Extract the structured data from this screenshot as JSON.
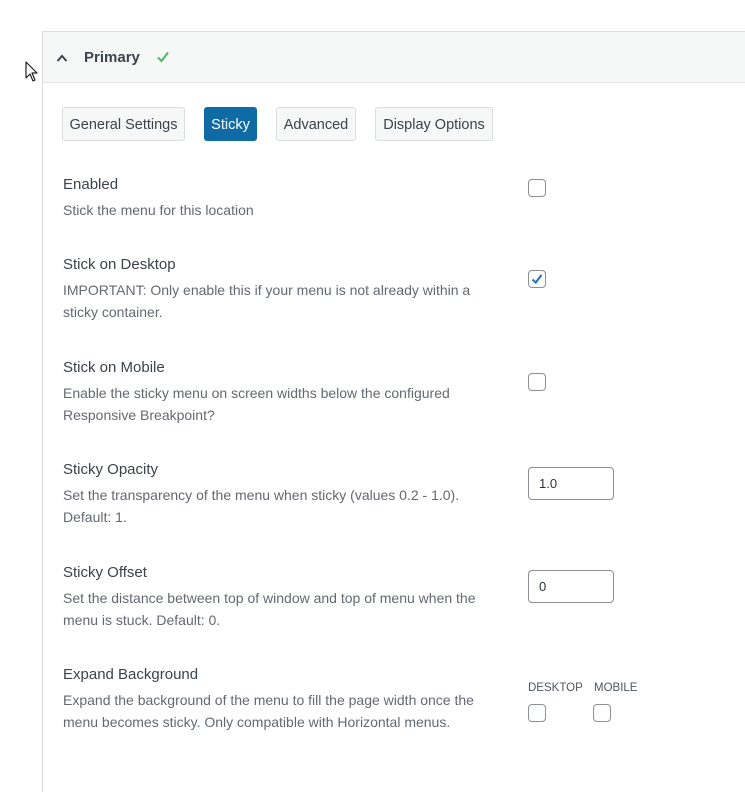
{
  "panel": {
    "title": "Primary"
  },
  "tabs": [
    {
      "label": "General Settings",
      "active": false
    },
    {
      "label": "Sticky",
      "active": true
    },
    {
      "label": "Advanced",
      "active": false
    },
    {
      "label": "Display Options",
      "active": false
    }
  ],
  "settings": {
    "enabled": {
      "title": "Enabled",
      "desc": "Stick the menu for this location",
      "checked": false
    },
    "stick_desktop": {
      "title": "Stick on Desktop",
      "desc": "IMPORTANT: Only enable this if your menu is not already within a sticky container.",
      "checked": true
    },
    "stick_mobile": {
      "title": "Stick on Mobile",
      "desc": "Enable the sticky menu on screen widths below the configured Responsive Breakpoint?",
      "checked": false
    },
    "opacity": {
      "title": "Sticky Opacity",
      "desc": "Set the transparency of the menu when sticky (values 0.2 - 1.0). Default: 1.",
      "value": "1.0"
    },
    "offset": {
      "title": "Sticky Offset",
      "desc": "Set the distance between top of window and top of menu when the menu is stuck. Default: 0.",
      "value": "0"
    },
    "expand_bg": {
      "title": "Expand Background",
      "desc": "Expand the background of the menu to fill the page width once the menu becomes sticky. Only compatible with Horizontal menus.",
      "desktop_label": "DESKTOP",
      "mobile_label": "MOBILE",
      "desktop_checked": false,
      "mobile_checked": false
    }
  },
  "colors": {
    "accent": "#0f6ba4",
    "success": "#4ab866"
  }
}
